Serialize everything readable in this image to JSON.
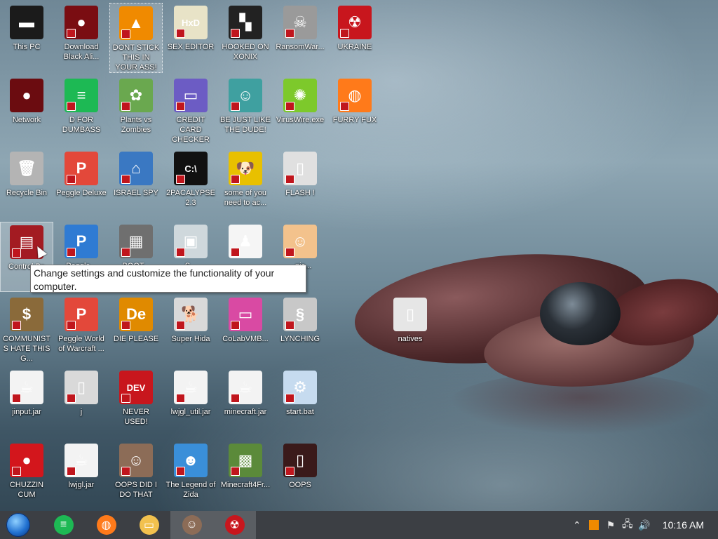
{
  "desktop": {
    "icons": [
      {
        "label": "This PC",
        "icon": "monitor-icon",
        "color": "#1b1b1b",
        "glyph": "▬"
      },
      {
        "label": "Network",
        "icon": "red-orb-icon",
        "color": "#6b0c10",
        "glyph": "●"
      },
      {
        "label": "Recycle Bin",
        "icon": "trash-can-icon",
        "color": "#b4b4b4",
        "glyph": "🗑"
      },
      {
        "label": "Control Pa",
        "icon": "control-panel-icon",
        "color": "#a31b22",
        "glyph": "▤"
      },
      {
        "label": "COMMUNISTS HATE THIS G...",
        "icon": "money-bag-icon",
        "color": "#8a6a3a",
        "glyph": "$"
      },
      {
        "label": "jinput.jar",
        "icon": "java-icon",
        "color": "#f3f3f3",
        "glyph": "☕"
      },
      {
        "label": "CHUZZIN CUM",
        "icon": "red-fuzzball-icon",
        "color": "#d3161c",
        "glyph": "●"
      },
      {
        "label": "Download Black Ali...",
        "icon": "red-orb-icon",
        "color": "#7a0d12",
        "glyph": "●"
      },
      {
        "label": "D FOR DUMBASS",
        "icon": "spotify-icon",
        "color": "#1db954",
        "glyph": "≡"
      },
      {
        "label": "Peggle Deluxe",
        "icon": "peggle-icon",
        "color": "#e3483a",
        "glyph": "P"
      },
      {
        "label": "Peggle...",
        "icon": "peggle-blue-icon",
        "color": "#2f7bd3",
        "glyph": "P"
      },
      {
        "label": "Peggle World of Warcraft ...",
        "icon": "peggle-icon",
        "color": "#e3483a",
        "glyph": "P"
      },
      {
        "label": "j",
        "icon": "file-icon",
        "color": "#d9d9d9",
        "glyph": "▯"
      },
      {
        "label": "lwjgl.jar",
        "icon": "java-icon",
        "color": "#f3f3f3",
        "glyph": "☕"
      },
      {
        "label": "DONT STICK THIS IN YOUR ASS!",
        "icon": "vlc-cone-icon",
        "color": "#f08a00",
        "glyph": "▲"
      },
      {
        "label": "Plants vs Zombies",
        "icon": "plants-icon",
        "color": "#6aa84f",
        "glyph": "✿"
      },
      {
        "label": "ISRAEL SPY",
        "icon": "network-icon",
        "color": "#3a78c2",
        "glyph": "⌂"
      },
      {
        "label": "BOOT...",
        "icon": "stack-icon",
        "color": "#6f6f6f",
        "glyph": "▦"
      },
      {
        "label": "DIE PLEASE",
        "icon": "de-icon",
        "color": "#e08a00",
        "glyph": "De"
      },
      {
        "label": "NEVER USED!",
        "icon": "dev-cpp-icon",
        "color": "#c8161d",
        "glyph": "DEV"
      },
      {
        "label": "OOPS DID I DO THAT",
        "icon": "portrait-icon",
        "color": "#8c6c57",
        "glyph": "☺"
      },
      {
        "label": "SEX EDITOR",
        "icon": "hxd-icon",
        "color": "#e8e3c7",
        "glyph": "HxD"
      },
      {
        "label": "CREDIT CARD CHECKER",
        "icon": "credit-card-icon",
        "color": "#6c5cc4",
        "glyph": "▭"
      },
      {
        "label": "2PACALYPSE 2.3",
        "icon": "terminal-icon",
        "color": "#111111",
        "glyph": "C:\\"
      },
      {
        "label": "S...",
        "icon": "window-icon",
        "color": "#cfd8dc",
        "glyph": "▣"
      },
      {
        "label": "Super Hida",
        "icon": "pixel-dog-icon",
        "color": "#d9d9d9",
        "glyph": "🐕"
      },
      {
        "label": "lwjgl_util.jar",
        "icon": "java-icon",
        "color": "#f3f3f3",
        "glyph": "☕"
      },
      {
        "label": "The Legend of Zida",
        "icon": "pixel-hero-icon",
        "color": "#3a8fd9",
        "glyph": "☻"
      },
      {
        "label": "HOOKED ON XONIX",
        "icon": "xonix-icon",
        "color": "#222222",
        "glyph": "▚"
      },
      {
        "label": "BE JUST LIKE THE DUDE!",
        "icon": "santa-icon",
        "color": "#3fa0a0",
        "glyph": "☺"
      },
      {
        "label": "some of you need to ac...",
        "icon": "dog-icon",
        "color": "#e8c000",
        "glyph": "🐶"
      },
      {
        "label": "...",
        "icon": "chess-icon",
        "color": "#f5f5f5",
        "glyph": "♟"
      },
      {
        "label": "CoLabVMB...",
        "icon": "monitor-pink-icon",
        "color": "#d94aa3",
        "glyph": "▭"
      },
      {
        "label": "minecraft.jar",
        "icon": "java-icon",
        "color": "#f3f3f3",
        "glyph": "☕"
      },
      {
        "label": "Minecraft4Fr...",
        "icon": "grass-block-icon",
        "color": "#5b8a3a",
        "glyph": "▩"
      },
      {
        "label": "RansomWar...",
        "icon": "skull-icon",
        "color": "#9a9a9a",
        "glyph": "☠"
      },
      {
        "label": "VirusWire.exe",
        "icon": "lime-icon",
        "color": "#7dc92b",
        "glyph": "✺"
      },
      {
        "label": "FLASH !",
        "icon": "book-icon",
        "color": "#e0e0e0",
        "glyph": "▯"
      },
      {
        "label": "...nic...",
        "icon": "doctor-icon",
        "color": "#f3c28c",
        "glyph": "☺"
      },
      {
        "label": "LYNCHING",
        "icon": "noose-icon",
        "color": "#c8c8c8",
        "glyph": "§"
      },
      {
        "label": "start.bat",
        "icon": "gears-icon",
        "color": "#c6dbef",
        "glyph": "⚙"
      },
      {
        "label": "OOPS",
        "icon": "dark-card-icon",
        "color": "#3a1a1a",
        "glyph": "▯"
      },
      {
        "label": "UKRAINE",
        "icon": "radiation-icon",
        "color": "#c8161d",
        "glyph": "☢"
      },
      {
        "label": "FURRY FUX",
        "icon": "firefox-icon",
        "color": "#ff7a1a",
        "glyph": "◍"
      }
    ],
    "floating_icon": {
      "label": "natives",
      "icon": "folder-icon",
      "color": "#e6e6e6",
      "glyph": "▯"
    }
  },
  "tooltip": {
    "text": "Change settings and customize the functionality of your computer."
  },
  "taskbar": {
    "apps": [
      {
        "name": "spotify-icon",
        "color": "#1db954",
        "glyph": "≡"
      },
      {
        "name": "firefox-icon",
        "color": "#ff7a1a",
        "glyph": "◍"
      },
      {
        "name": "file-explorer-icon",
        "color": "#f2c14e",
        "glyph": "▭"
      },
      {
        "name": "portrait-icon",
        "color": "#8c6c57",
        "glyph": "☺"
      },
      {
        "name": "radiation-icon",
        "color": "#c8161d",
        "glyph": "☢"
      }
    ],
    "clock": "10:16 AM"
  }
}
